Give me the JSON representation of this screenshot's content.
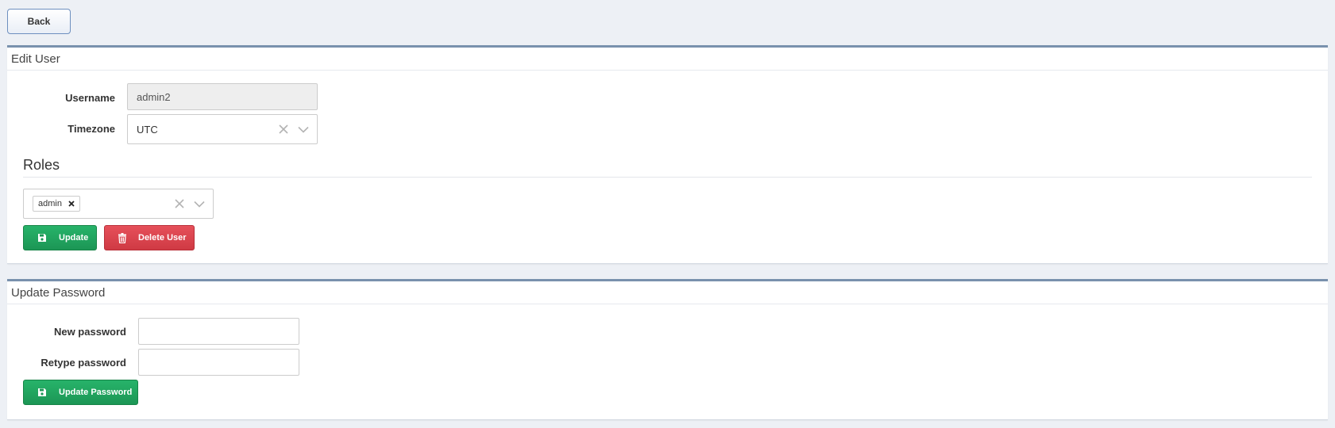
{
  "back": {
    "label": "Back"
  },
  "edit_user": {
    "title": "Edit User",
    "username_label": "Username",
    "username_value": "admin2",
    "timezone_label": "Timezone",
    "timezone_value": "UTC",
    "roles_title": "Roles",
    "roles": [
      "admin"
    ],
    "update_label": "Update",
    "delete_label": "Delete User"
  },
  "update_password": {
    "title": "Update Password",
    "new_password_label": "New password",
    "new_password_value": "",
    "retype_password_label": "Retype password",
    "retype_password_value": "",
    "submit_label": "Update Password"
  },
  "icons": {
    "clear": "clear-icon",
    "chevron": "chevron-down-icon",
    "save": "save-icon",
    "trash": "trash-icon",
    "remove_tag": "remove-tag-icon"
  },
  "colors": {
    "primary_green": "#1f9f5c",
    "danger_red": "#d9434c",
    "panel_border": "#7991ad",
    "back_border": "#6d8fbf"
  }
}
